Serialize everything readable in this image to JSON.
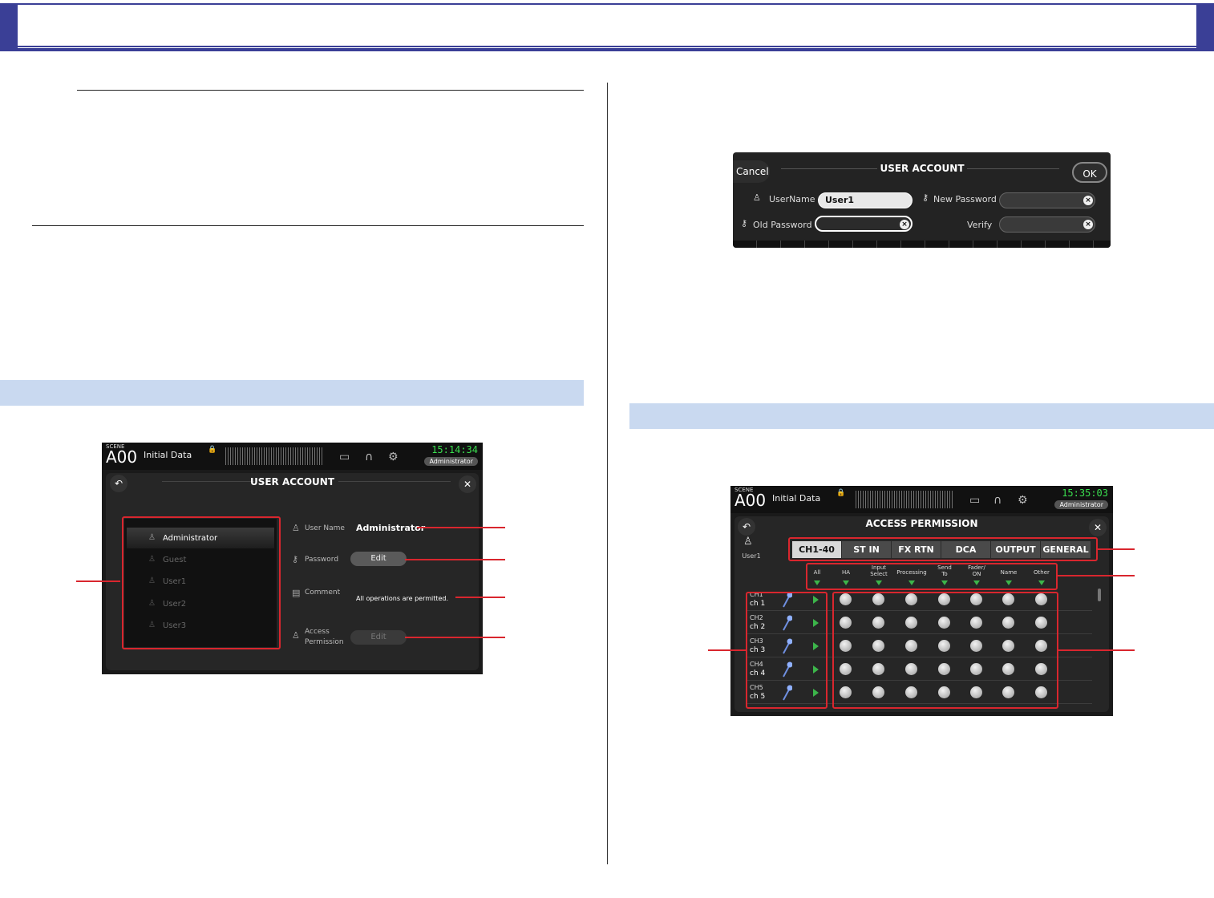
{
  "user_account_screen": {
    "scene_label": "SCENE",
    "scene_number": "A00",
    "scene_title": "Initial Data",
    "clock": "15:14:34",
    "current_user": "Administrator",
    "title": "USER ACCOUNT",
    "users": [
      "Administrator",
      "Guest",
      "User1",
      "User2",
      "User3"
    ],
    "labels": {
      "user_name": "User Name",
      "password": "Password",
      "comment": "Comment",
      "access_1": "Access",
      "access_2": "Permission"
    },
    "values": {
      "user_name": "Administrator",
      "comment": "All operations are permitted."
    },
    "edit_button": "Edit",
    "access_edit_button": "Edit"
  },
  "password_dialog": {
    "cancel": "Cancel",
    "title": "USER ACCOUNT",
    "ok": "OK",
    "labels": {
      "username": "UserName",
      "new_password": "New Password",
      "old_password": "Old Password",
      "verify": "Verify"
    },
    "username_value": "User1",
    "clear_glyph": "×"
  },
  "access_permission_screen": {
    "scene_label": "SCENE",
    "scene_number": "A00",
    "scene_title": "Initial Data",
    "clock": "15:35:03",
    "current_user": "Administrator",
    "title": "ACCESS PERMISSION",
    "user": "User1",
    "tabs": [
      "CH1-40",
      "ST IN",
      "FX RTN",
      "DCA",
      "OUTPUT",
      "GENERAL"
    ],
    "column_headers": [
      "All",
      "HA",
      "Input\nSelect",
      "Processing",
      "Send\nTo",
      "Fader/\nON",
      "Name",
      "Other"
    ],
    "channels": [
      {
        "id": "CH1",
        "name": "ch 1"
      },
      {
        "id": "CH2",
        "name": "ch 2"
      },
      {
        "id": "CH3",
        "name": "ch 3"
      },
      {
        "id": "CH4",
        "name": "ch 4"
      },
      {
        "id": "CH5",
        "name": "ch 5"
      }
    ]
  },
  "colors": {
    "accent_red": "#d9262e",
    "band_blue": "#c9d9f0",
    "header_navy": "#3a3f96",
    "clock_green": "#3adf4f"
  }
}
